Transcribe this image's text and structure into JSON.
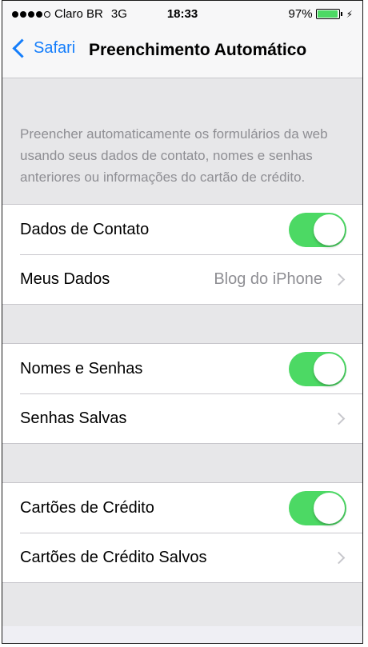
{
  "status": {
    "carrier": "Claro BR",
    "network": "3G",
    "time": "18:33",
    "battery_text": "97%",
    "battery_level": 0.97,
    "battery_color": "#4cd964"
  },
  "nav": {
    "back_label": "Safari",
    "title": "Preenchimento Automático"
  },
  "description": "Preencher automaticamente os formulários da web usando seus dados de contato, nomes e senhas anteriores ou informações do cartão de crédito.",
  "groups": [
    {
      "toggle": {
        "label": "Dados de Contato",
        "on": true
      },
      "row": {
        "label": "Meus Dados",
        "value": "Blog do iPhone"
      }
    },
    {
      "toggle": {
        "label": "Nomes e Senhas",
        "on": true
      },
      "row": {
        "label": "Senhas Salvas"
      }
    },
    {
      "toggle": {
        "label": "Cartões de Crédito",
        "on": true
      },
      "row": {
        "label": "Cartões de Crédito Salvos"
      }
    }
  ],
  "colors": {
    "accent": "#157efb",
    "toggle_on": "#4cd964",
    "secondary_text": "#8e8e93"
  }
}
